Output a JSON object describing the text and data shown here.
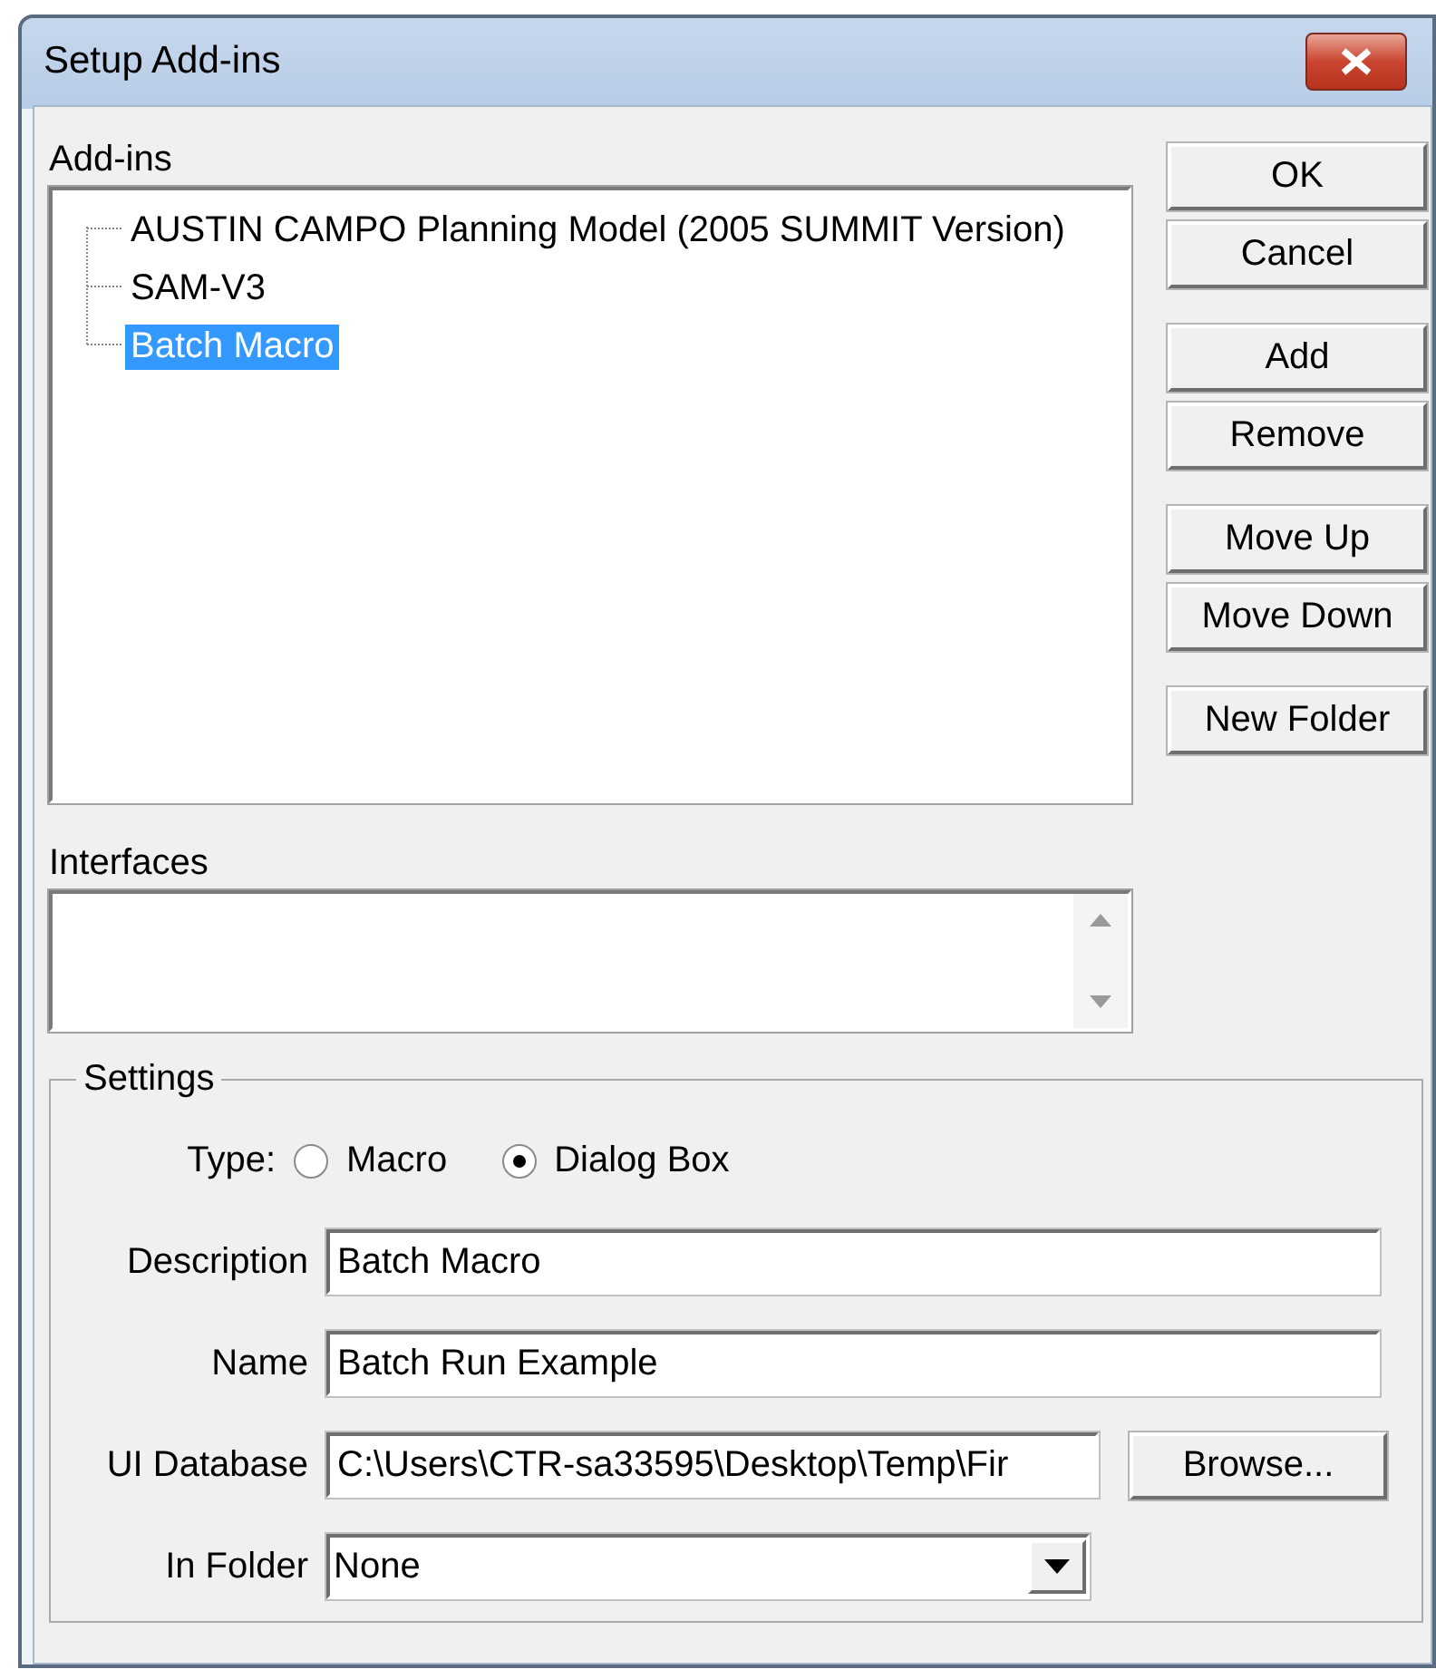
{
  "window": {
    "title": "Setup Add-ins"
  },
  "addins": {
    "label": "Add-ins",
    "items": [
      {
        "label": "AUSTIN CAMPO Planning Model (2005 SUMMIT Version)",
        "selected": false
      },
      {
        "label": "SAM-V3",
        "selected": false
      },
      {
        "label": "Batch Macro",
        "selected": true
      }
    ]
  },
  "button_groups": [
    [
      "OK",
      "Cancel"
    ],
    [
      "Add",
      "Remove"
    ],
    [
      "Move Up",
      "Move Down"
    ],
    [
      "New Folder"
    ]
  ],
  "interfaces": {
    "label": "Interfaces"
  },
  "settings": {
    "legend": "Settings",
    "type_label": "Type:",
    "types": [
      {
        "label": "Macro",
        "selected": false
      },
      {
        "label": "Dialog Box",
        "selected": true
      }
    ],
    "description": {
      "label": "Description",
      "value": "Batch Macro"
    },
    "name": {
      "label": "Name",
      "value": "Batch Run Example"
    },
    "ui_database": {
      "label": "UI Database",
      "value": "C:\\Users\\CTR-sa33595\\Desktop\\Temp\\Fir",
      "button": "Browse..."
    },
    "in_folder": {
      "label": "In Folder",
      "value": "None"
    }
  }
}
